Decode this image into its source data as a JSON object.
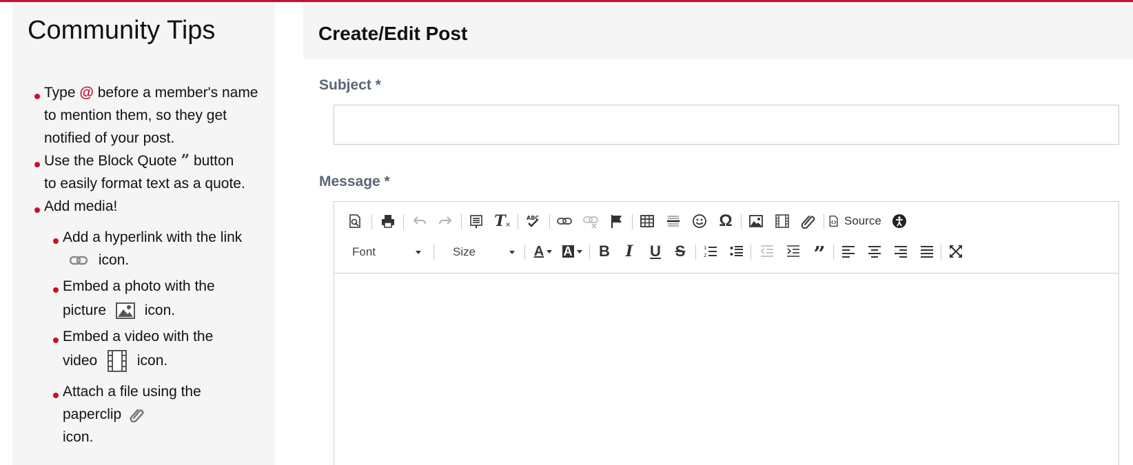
{
  "sidebar": {
    "title": "Community Tips",
    "tips": [
      {
        "lines": [
          "before a member's name",
          "to mention them, so they get",
          "notified of your post."
        ],
        "prefix": "Type",
        "at_symbol": "@"
      },
      {
        "prefix": "Use the Block Quote",
        "quote_glyph": "”",
        "suffix": "button",
        "line2": "to easily format text as a quote."
      },
      {
        "text": "Add media!"
      },
      {
        "line1": "Add a hyperlink with the link",
        "line2": "icon.",
        "icon": "link-icon"
      },
      {
        "line1": "Embed a photo with the",
        "line2_prefix": "picture",
        "line2_suffix": "icon.",
        "icon": "image-icon"
      },
      {
        "line1": "Embed a video with the",
        "line2_prefix": "video",
        "line2_suffix": "icon.",
        "icon": "video-icon"
      },
      {
        "line1": "Attach a file using the",
        "line2": "paperclip",
        "line3": "icon.",
        "icon": "paperclip-icon"
      }
    ]
  },
  "main": {
    "title": "Create/Edit Post",
    "subject_label": "Subject *",
    "subject_value": "",
    "message_label": "Message *",
    "toolbar": {
      "source_label": "Source",
      "font_label": "Font",
      "size_label": "Size",
      "buttons_row1": [
        "preview-icon",
        "print-icon",
        "undo-icon",
        "redo-icon",
        "paste-from-word-icon",
        "remove-format-icon",
        "spellcheck-icon",
        "link-icon",
        "unlink-icon",
        "anchor-flag-icon",
        "table-icon",
        "horizontal-line-icon",
        "smiley-icon",
        "special-char-icon",
        "image-icon",
        "video-icon",
        "attach-icon",
        "source-icon",
        "accessibility-icon"
      ],
      "buttons_row2": [
        "text-color-icon",
        "bg-color-icon",
        "bold-icon",
        "italic-icon",
        "underline-icon",
        "strikethrough-icon",
        "numbered-list-icon",
        "bulleted-list-icon",
        "outdent-icon",
        "indent-icon",
        "blockquote-icon",
        "align-left-icon",
        "align-center-icon",
        "align-right-icon",
        "justify-icon",
        "maximize-icon"
      ],
      "glyphs": {
        "bold": "B",
        "italic": "I",
        "underline": "U",
        "strike": "S",
        "omega": "Ω",
        "text_color": "A",
        "bg_color": "A",
        "blockquote": "”"
      }
    }
  },
  "colors": {
    "accent": "#c8102e",
    "label": "#5a6575",
    "panel": "#f5f5f5"
  }
}
